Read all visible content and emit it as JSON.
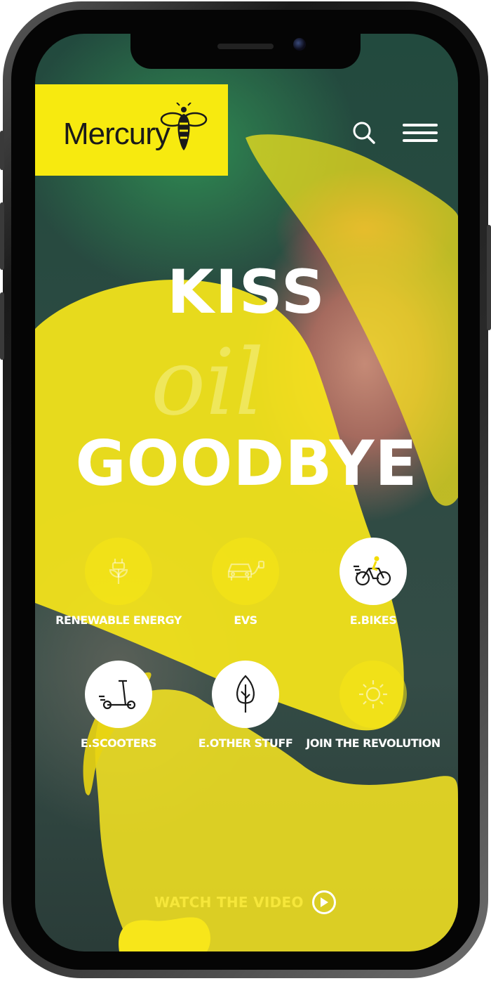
{
  "brand": {
    "name": "Mercury",
    "accent": "#f7ea0f"
  },
  "header": {
    "search_icon": "search-icon",
    "menu_icon": "hamburger-menu-icon"
  },
  "hero": {
    "line1": "KISS",
    "script": "oil",
    "line2": "GOODBYE"
  },
  "categories": [
    {
      "label": "RENEWABLE ENERGY",
      "icon": "plug-plant-icon",
      "active": false
    },
    {
      "label": "EVS",
      "icon": "car-charger-icon",
      "active": false
    },
    {
      "label": "E.BIKES",
      "icon": "ebike-icon",
      "active": true
    },
    {
      "label": "E.SCOOTERS",
      "icon": "scooter-icon",
      "active": true
    },
    {
      "label": "E.OTHER STUFF",
      "icon": "tree-icon",
      "active": true
    },
    {
      "label": "JOIN THE REVOLUTION",
      "icon": "sun-icon",
      "active": false
    }
  ],
  "cta": {
    "label": "WATCH THE VIDEO",
    "icon": "play-icon"
  }
}
